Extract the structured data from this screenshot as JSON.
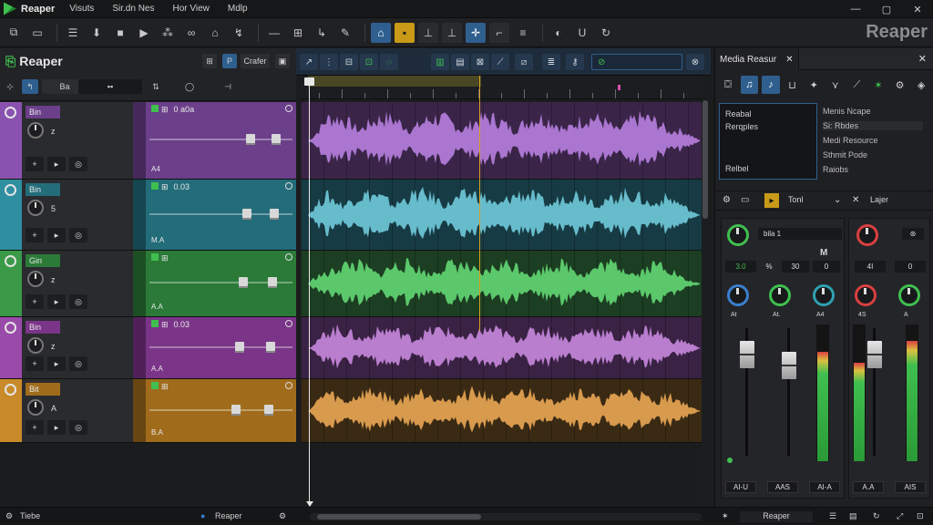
{
  "menu": {
    "app": "Reaper",
    "items": [
      "Visuts",
      "Sir.dn Nes",
      "Hor View",
      "Mdlp"
    ]
  },
  "window_controls": [
    "—",
    "▢",
    "✕"
  ],
  "brand": "Reaper",
  "toolbar_icons": [
    "snap-icon",
    "folder-icon",
    "list-icon",
    "down-arrow-icon",
    "stop-icon",
    "play-icon",
    "record-icon",
    "loop-icon",
    "marker-icon",
    "ripple-icon",
    "link-icon",
    "split-icon",
    "glue-icon",
    "trim-icon",
    "envelope-icon",
    "lock-icon",
    "grid-yellow-icon",
    "cursor-icon",
    "move-icon",
    "crosshair-icon",
    "zoom-icon",
    "metronome-icon",
    "tune-icon",
    "return-icon"
  ],
  "tcp": {
    "title": "Reaper",
    "header_btn_label": "Crafer",
    "row2_btn": "Ba",
    "row2_btn2": "▪▪"
  },
  "tracks": [
    {
      "name": "Bin",
      "knob": "z",
      "fx_top": "0 a0a",
      "fx_label": "A4",
      "color": "#8a52b0",
      "fx_color": "#6b3f8a",
      "wave": "#b07ad8",
      "lane": "#3a2548"
    },
    {
      "name": "Bin",
      "knob": "5",
      "fx_top": "0.03",
      "fx_label": "M.A",
      "color": "#2f8fa0",
      "fx_color": "#236c7a",
      "wave": "#6cc3d4",
      "lane": "#173b44"
    },
    {
      "name": "Gin",
      "knob": "z",
      "fx_top": "",
      "fx_label": "A.A",
      "color": "#3a9a48",
      "fx_color": "#2b7a38",
      "wave": "#5fd070",
      "lane": "#1c3e22"
    },
    {
      "name": "Bin",
      "knob": "z",
      "fx_top": "0.03",
      "fx_label": "A.A",
      "color": "#9a4aa8",
      "fx_color": "#7a3488",
      "wave": "#c084d6",
      "lane": "#3a2244"
    },
    {
      "name": "Bit",
      "knob": "A",
      "fx_top": "",
      "fx_label": "B.A",
      "color": "#c98a2a",
      "fx_color": "#a06c1c",
      "wave": "#e0a050",
      "lane": "#3a2a14"
    }
  ],
  "right_panel": {
    "tab": "Media Reasur",
    "browser_items": [
      "Reabal",
      "Rerqples",
      "Relbel"
    ],
    "list_items": [
      "Menis Ncape",
      "Si: Rbdes",
      "Medi Resource",
      "Sthmit Pode",
      "Raiobs"
    ],
    "mid_label": "Tonl",
    "mid_label2": "Lajer",
    "strip1": {
      "name": "bila 1",
      "m": "M",
      "vals": [
        "3.0",
        "%",
        "30",
        "0"
      ],
      "foot": "AI-U"
    },
    "strip2": {
      "vals": [
        "4I",
        "0"
      ],
      "foot": "A.A"
    },
    "footer_labels": [
      "AI-U",
      "AAS",
      "AI-A",
      "AIS"
    ],
    "knob_labels": [
      "At",
      "At.",
      "A4",
      "4S",
      "A"
    ]
  },
  "bottom": {
    "left": "Tiebe",
    "center": "Reaper",
    "right": "Reaper"
  }
}
